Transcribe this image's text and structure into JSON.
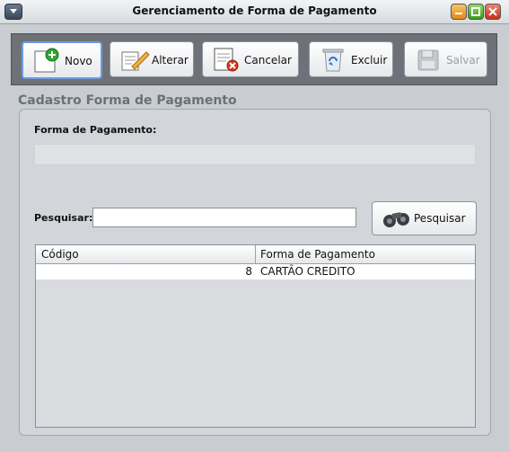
{
  "window": {
    "title": "Gerenciamento de Forma de Pagamento"
  },
  "toolbar": {
    "novo": "Novo",
    "alterar": "Alterar",
    "cancelar": "Cancelar",
    "excluir": "Excluir",
    "salvar": "Salvar"
  },
  "panel": {
    "title": "Cadastro Forma de Pagamento"
  },
  "form": {
    "forma_label": "Forma de Pagamento:",
    "forma_value": "",
    "pesquisar_label": "Pesquisar:",
    "pesquisar_value": "",
    "pesquisar_button": "Pesquisar"
  },
  "table": {
    "columns": [
      "Código",
      "Forma de Pagamento"
    ],
    "rows": [
      {
        "codigo": "8",
        "forma": "CARTÃO CREDITO"
      }
    ]
  }
}
